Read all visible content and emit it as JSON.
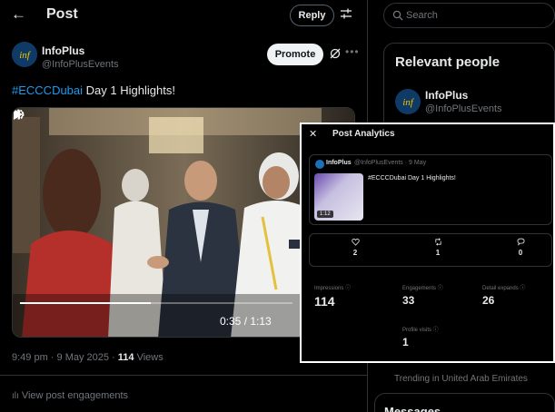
{
  "header": {
    "title": "Post",
    "reply_label": "Reply"
  },
  "author": {
    "name": "InfoPlus",
    "handle": "@InfoPlusEvents"
  },
  "promote_label": "Promote",
  "post": {
    "hashtag": "#ECCCDubai",
    "text": " Day 1 Highlights!"
  },
  "video": {
    "time": "0:35 / 1:13",
    "progress": 0.48
  },
  "meta": {
    "time_date": "9:49 pm · 9 May 2025 · ",
    "views_count": "114",
    "views_label": " Views"
  },
  "engagements_link": "View post engagements",
  "search": {
    "placeholder": "Search"
  },
  "relevant": {
    "title": "Relevant people",
    "name": "InfoPlus",
    "handle": "@InfoPlusEvents"
  },
  "trending": "Trending in United Arab Emirates",
  "messages": "Messages",
  "analytics": {
    "title": "Post Analytics",
    "preview_name": "InfoPlus",
    "preview_handle": "@InfoPlusEvents · 9 May",
    "preview_text": "#ECCCDubai Day 1 Highlights!",
    "duration": "1:12",
    "likes": "2",
    "reposts": "1",
    "replies": "0",
    "impressions_label": "Impressions ⓘ",
    "impressions": "114",
    "engagements_label": "Engagements ⓘ",
    "engagements": "33",
    "expands_label": "Detail expands ⓘ",
    "expands": "26",
    "profile_label": "Profile visits ⓘ",
    "profile": "1"
  },
  "icons": [
    "back-arrow",
    "tune",
    "grok",
    "more",
    "play",
    "volume",
    "settings",
    "search",
    "close",
    "heart",
    "repost",
    "reply",
    "chart"
  ]
}
